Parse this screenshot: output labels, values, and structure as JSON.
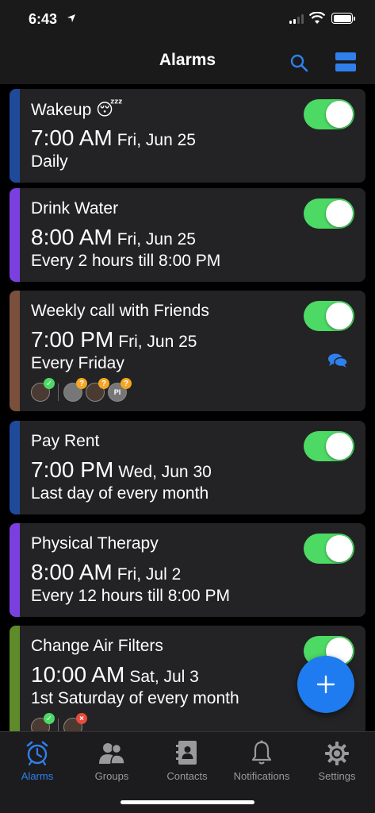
{
  "status": {
    "time": "6:43"
  },
  "header": {
    "title": "Alarms"
  },
  "alarms": [
    {
      "title": "Wakeup 😴",
      "time": "7:00 AM",
      "date": "Fri, Jun 25",
      "repeat": "Daily",
      "color": "#1f4a9a",
      "enabled": true
    },
    {
      "title": "Drink Water",
      "time": "8:00 AM",
      "date": "Fri, Jun 25",
      "repeat": "Every 2 hours till 8:00 PM",
      "color": "#7b3fe0",
      "enabled": true
    },
    {
      "title": "Weekly call with Friends",
      "time": "7:00 PM",
      "date": "Fri, Jun 25",
      "repeat": "Every Friday",
      "color": "#7a4f3b",
      "enabled": true,
      "participant_initials": "PI"
    },
    {
      "title": "Pay Rent",
      "time": "7:00 PM",
      "date": "Wed, Jun 30",
      "repeat": "Last day of every month",
      "color": "#1f4a9a",
      "enabled": true
    },
    {
      "title": "Physical Therapy",
      "time": "8:00 AM",
      "date": "Fri, Jul 2",
      "repeat": "Every 12 hours till 8:00 PM",
      "color": "#7b3fe0",
      "enabled": true
    },
    {
      "title": "Change Air Filters",
      "time": "10:00 AM",
      "date": "Sat, Jul 3",
      "repeat": "1st Saturday of every month",
      "color": "#5e8a2a",
      "enabled": true
    }
  ],
  "tabs": [
    {
      "label": "Alarms",
      "icon": "alarm-clock-icon",
      "active": true
    },
    {
      "label": "Groups",
      "icon": "groups-icon",
      "active": false
    },
    {
      "label": "Contacts",
      "icon": "contacts-icon",
      "active": false
    },
    {
      "label": "Notifications",
      "icon": "bell-icon",
      "active": false
    },
    {
      "label": "Settings",
      "icon": "gear-icon",
      "active": false
    }
  ],
  "colors": {
    "accent": "#2f80ed",
    "toggle_on": "#4cd964",
    "fab": "#1e7cf0"
  }
}
